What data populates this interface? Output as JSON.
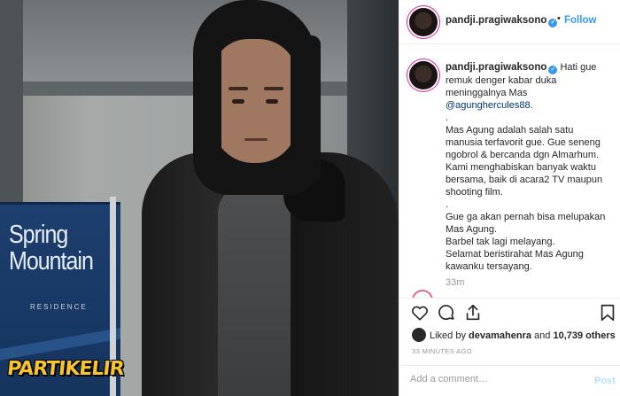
{
  "photo": {
    "sign_text": "Spring Mountain",
    "sign_sub": "RESIDENCE",
    "watermark": "PARTIKELIR"
  },
  "header": {
    "username": "pandji.pragiwaksono",
    "verified_icon": "verified-badge-icon",
    "separator": "•",
    "follow_label": "Follow"
  },
  "caption": {
    "username": "pandji.pragiwaksono",
    "line1": "Hati gue remuk denger kabar duka meninggalnya Mas",
    "mention": "@agunghercules88",
    "mention_suffix": ".",
    "dot1": ".",
    "para1": "Mas Agung adalah salah satu manusia terfavorit gue. Gue seneng ngobrol & bercanda dgn Almarhum. Kami menghabiskan banyak waktu bersama, baik di acara2 TV maupun shooting film.",
    "dot2": ".",
    "para2_l1": "Gue ga akan pernah bisa melupakan Mas Agung.",
    "para2_l2": "Barbel tak lagi melayang.",
    "para2_l3": "Selamat beristirahat Mas Agung kawanku tersayang.",
    "relative_time": "33m"
  },
  "actions": {
    "like_icon": "heart-icon",
    "comment_icon": "comment-bubble-icon",
    "share_icon": "share-icon",
    "save_icon": "bookmark-icon"
  },
  "likes": {
    "prefix": "Liked by",
    "user": "devamahenra",
    "middle": "and",
    "others": "10,739 others"
  },
  "timestamp": "33 MINUTES AGO",
  "comment_box": {
    "placeholder": "Add a comment…",
    "post_label": "Post"
  },
  "colors": {
    "accent_blue": "#3897f0",
    "post_disabled": "#b2dffc",
    "watermark_yellow": "#f6c42b"
  }
}
